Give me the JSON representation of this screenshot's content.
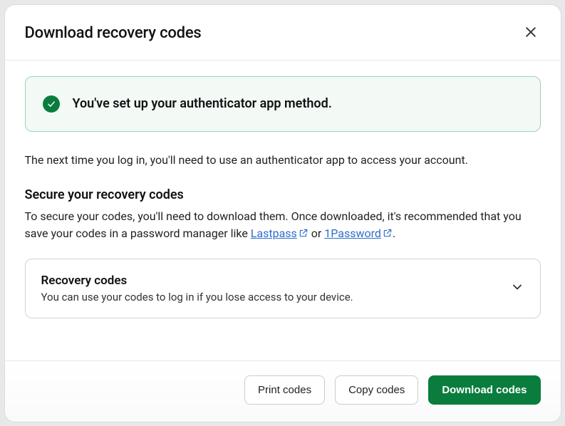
{
  "modal": {
    "title": "Download recovery codes"
  },
  "banner": {
    "message": "You've set up your authenticator app method."
  },
  "intro": "The next time you log in, you'll need to use an authenticator app to access your account.",
  "section": {
    "heading": "Secure your recovery codes",
    "desc_prefix": "To secure your codes, you'll need to download them. Once downloaded, it's recommended that you save your codes in a password manager like ",
    "link1": "Lastpass",
    "desc_middle": " or ",
    "link2": "1Password",
    "desc_suffix": "."
  },
  "recovery": {
    "title": "Recovery codes",
    "desc": "You can use your codes to log in if you lose access to your device."
  },
  "footer": {
    "print": "Print codes",
    "copy": "Copy codes",
    "download": "Download codes"
  }
}
